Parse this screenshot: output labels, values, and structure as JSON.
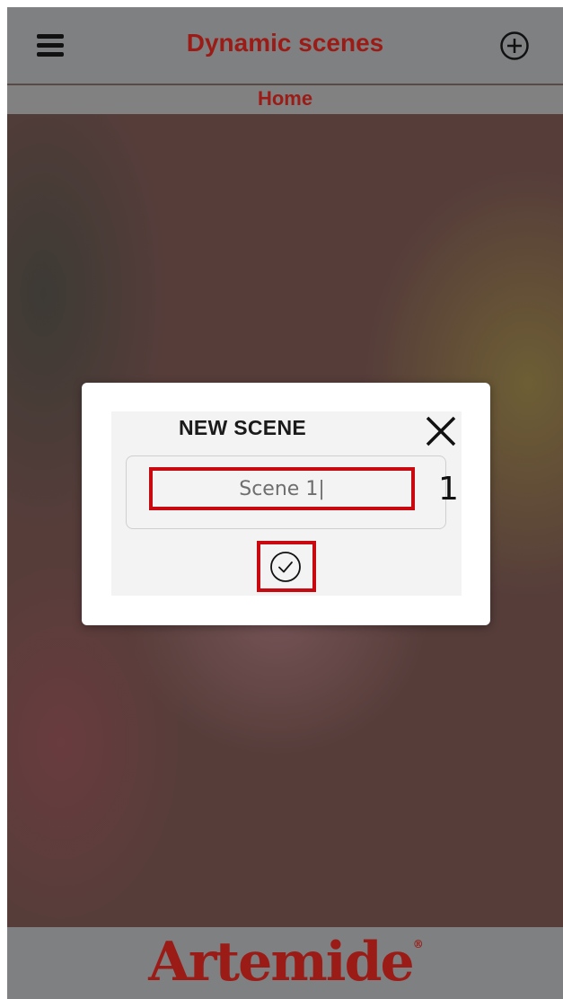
{
  "header": {
    "title": "Dynamic scenes",
    "menu_icon": "hamburger-menu-icon",
    "add_icon": "plus-circle-icon"
  },
  "breadcrumb": "Home",
  "footer": {
    "logo_text": "Artemide",
    "logo_mark": "®"
  },
  "dialog": {
    "title": "NEW SCENE",
    "close_icon": "close-icon",
    "scene_name_value": "Scene 1|",
    "step_number": "1",
    "confirm_icon": "check-circle-icon"
  },
  "colors": {
    "brand_red": "#9b1b16",
    "highlight_red": "#c8090f",
    "bar_gray": "#7f8082"
  }
}
